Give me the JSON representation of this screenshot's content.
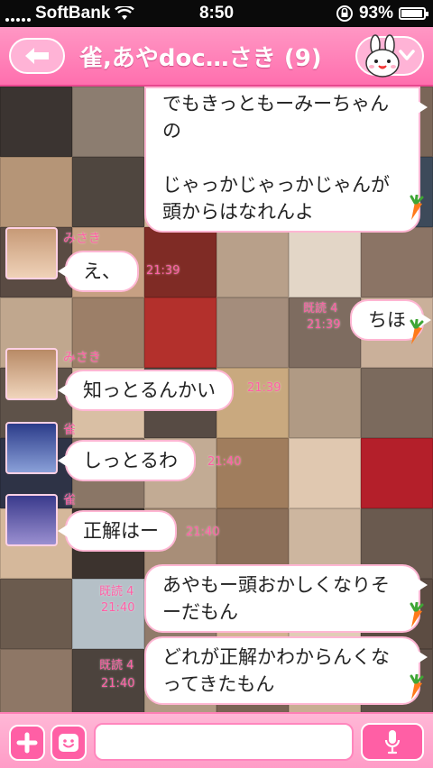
{
  "status_bar": {
    "carrier": "SoftBank",
    "time": "8:50",
    "battery": "93%"
  },
  "header": {
    "title": "雀,あやdoc…さき (9)",
    "back_icon": "back-arrow-icon",
    "mascot_icon": "bunny-mascot-icon"
  },
  "messages": [
    {
      "side": "out",
      "lines": [
        "でもきっともーみーちゃん",
        "の",
        "",
        "じゃっかじゃっかじゃんが",
        "頭からはなれんよ"
      ],
      "time": ""
    },
    {
      "side": "in",
      "sender": "みさき",
      "text": "え、",
      "time": "21:39"
    },
    {
      "side": "out",
      "text": "ちほ",
      "time": "21:39",
      "read": "既読 4"
    },
    {
      "side": "in",
      "sender": "みさき",
      "text": "知っとるんかい",
      "time": "21:39"
    },
    {
      "side": "in",
      "sender": "雀",
      "text": "しっとるわ",
      "time": "21:40"
    },
    {
      "side": "in",
      "sender": "雀",
      "text": "正解はー",
      "time": "21:40"
    },
    {
      "side": "out",
      "lines": [
        "あやもー頭おかしくなりそ",
        "ーだもん"
      ],
      "time": "21:40",
      "read": "既読 4"
    },
    {
      "side": "out",
      "lines": [
        "どれが正解かわからんくな",
        "ってきたもん"
      ],
      "time": "21:40",
      "read": "既読 4"
    }
  ],
  "composer": {
    "placeholder": ""
  },
  "colors": {
    "header_pink": "#ff6fae",
    "accent_pink": "#ff5fa5",
    "bubble_border": "#ffb6d3"
  }
}
